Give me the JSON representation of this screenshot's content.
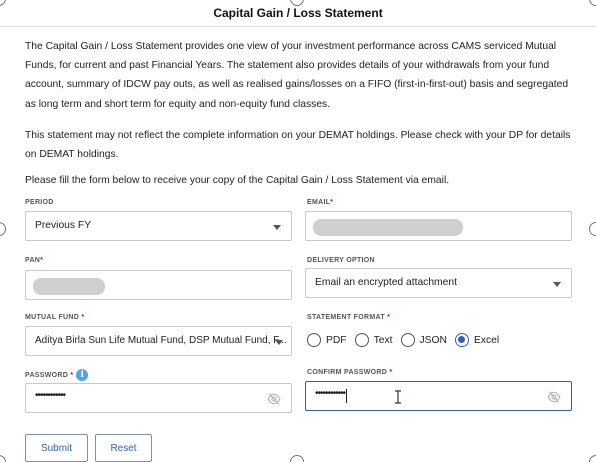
{
  "header": {
    "title": "Capital Gain / Loss Statement"
  },
  "intro": {
    "paragraph1": "The Capital Gain / Loss Statement provides one view of your investment performance across CAMS serviced Mutual Funds, for current and past Financial Years. The statement also provides details of your withdrawals from your fund account, summary of IDCW pay outs, as well as realised gains/losses on a FIFO (first-in-first-out) basis and segregated as long term and short term for equity and non-equity fund classes.",
    "paragraph2": "This statement may not reflect the complete information on your DEMAT holdings. Please check with your DP for details on DEMAT holdings.",
    "paragraph3": "Please fill the form below to receive your copy of the Capital Gain / Loss Statement via email."
  },
  "form": {
    "period": {
      "label": "PERIOD",
      "value": "Previous FY"
    },
    "email": {
      "label": "EMAIL",
      "required_mark": "*"
    },
    "pan": {
      "label": "PAN",
      "required_mark": "*"
    },
    "delivery_option": {
      "label": "DELIVERY OPTION",
      "value": "Email an encrypted attachment"
    },
    "mutual_fund": {
      "label": "MUTUAL FUND",
      "required_mark": " *",
      "value": "Aditya Birla Sun Life Mutual Fund, DSP Mutual Fund, F..."
    },
    "statement_format": {
      "label": "STATEMENT FORMAT",
      "required_mark": " *",
      "options": [
        "PDF",
        "Text",
        "JSON",
        "Excel"
      ],
      "selected": "Excel"
    },
    "password": {
      "label": "PASSWORD",
      "required_mark": " *",
      "info_icon": "i",
      "masked_value": "••••••••••••"
    },
    "confirm_password": {
      "label": "CONFIRM PASSWORD",
      "required_mark": " *",
      "masked_value": "••••••••••••"
    },
    "submit_label": "Submit",
    "reset_label": "Reset"
  },
  "colors": {
    "accent": "#2f5fb8",
    "required": "#d0021b",
    "info": "#4aa8e8",
    "border": "#c9c9c9"
  },
  "icons": [
    "chevron-down-icon",
    "eye-off-icon",
    "info-icon",
    "text-cursor-icon"
  ]
}
